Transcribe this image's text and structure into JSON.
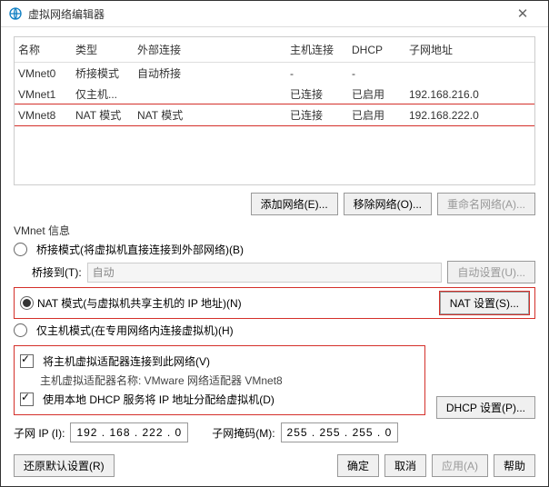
{
  "title": "虚拟网络编辑器",
  "cols": [
    "名称",
    "类型",
    "外部连接",
    "主机连接",
    "DHCP",
    "子网地址"
  ],
  "rows": [
    {
      "c": [
        "VMnet0",
        "桥接模式",
        "自动桥接",
        "-",
        "-",
        ""
      ]
    },
    {
      "c": [
        "VMnet1",
        "仅主机...",
        "",
        "已连接",
        "已启用",
        "192.168.216.0"
      ]
    },
    {
      "c": [
        "VMnet8",
        "NAT 模式",
        "NAT 模式",
        "已连接",
        "已启用",
        "192.168.222.0"
      ],
      "sel": true
    }
  ],
  "btn_add": "添加网络(E)...",
  "btn_del": "移除网络(O)...",
  "btn_ren": "重命名网络(A)...",
  "sect": "VMnet 信息",
  "opt_bridge": "桥接模式(将虚拟机直接连接到外部网络)(B)",
  "bridge_to": "桥接到(T):",
  "bridge_val": "自动",
  "btn_auto": "自动设置(U)...",
  "opt_nat": "NAT 模式(与虚拟机共享主机的 IP 地址)(N)",
  "btn_nat": "NAT 设置(S)...",
  "opt_host": "仅主机模式(在专用网络内连接虚拟机)(H)",
  "chk_adapter": "将主机虚拟适配器连接到此网络(V)",
  "adapter_name": "主机虚拟适配器名称: VMware 网络适配器 VMnet8",
  "chk_dhcp": "使用本地 DHCP 服务将 IP 地址分配给虚拟机(D)",
  "btn_dhcp": "DHCP 设置(P)...",
  "sub_ip_l": "子网 IP (I):",
  "sub_ip": "192 . 168 . 222 .  0",
  "sub_mask_l": "子网掩码(M):",
  "sub_mask": "255 . 255 . 255 .  0",
  "btn_restore": "还原默认设置(R)",
  "btn_ok": "确定",
  "btn_cancel": "取消",
  "btn_apply": "应用(A)",
  "btn_help": "帮助"
}
